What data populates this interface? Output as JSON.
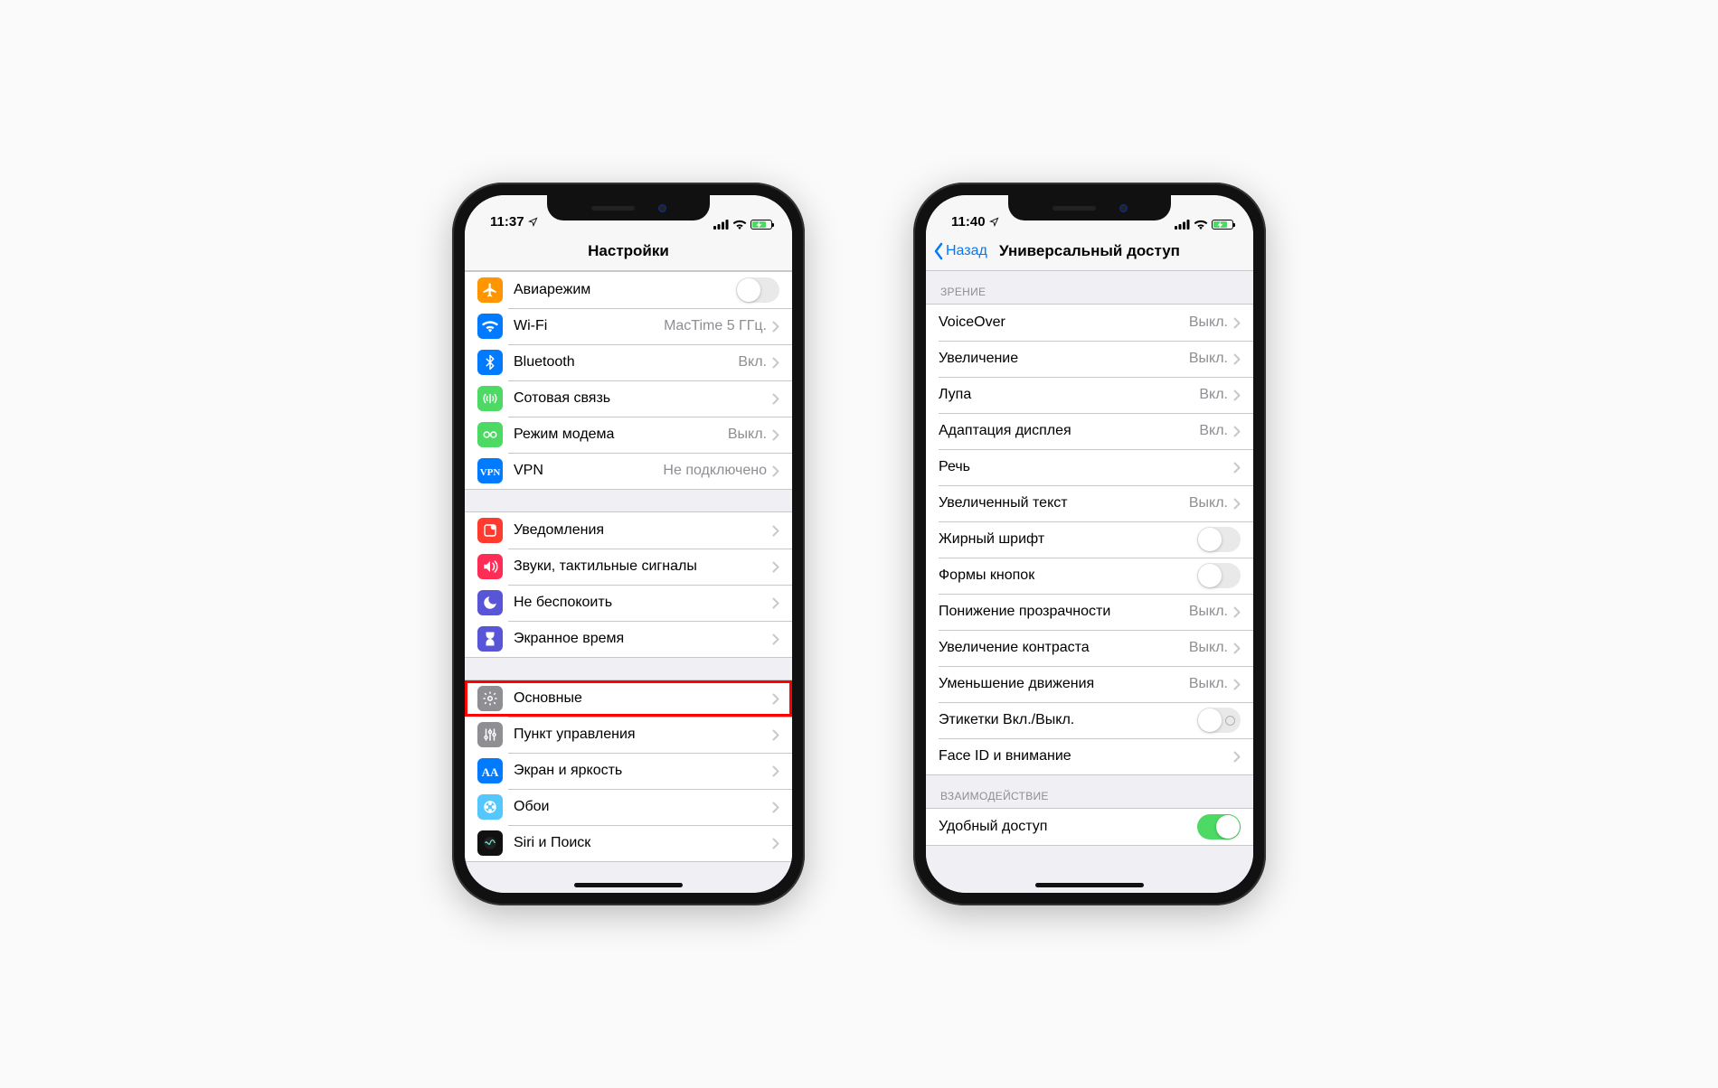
{
  "phone1": {
    "status": {
      "time": "11:37"
    },
    "title": "Настройки",
    "groups": [
      {
        "rows": [
          {
            "key": "airplane",
            "icon": "airplane",
            "iconColor": "#ff9500",
            "label": "Авиарежим",
            "control": "switch",
            "switchOn": false
          },
          {
            "key": "wifi",
            "icon": "wifi",
            "iconColor": "#007aff",
            "label": "Wi-Fi",
            "control": "value",
            "value": "MacTime 5 ГГц."
          },
          {
            "key": "bluetooth",
            "icon": "bluetooth",
            "iconColor": "#007aff",
            "label": "Bluetooth",
            "control": "value",
            "value": "Вкл."
          },
          {
            "key": "cellular",
            "icon": "cellular",
            "iconColor": "#4cd964",
            "label": "Сотовая связь",
            "control": "disclose"
          },
          {
            "key": "hotspot",
            "icon": "hotspot",
            "iconColor": "#4cd964",
            "label": "Режим модема",
            "control": "value",
            "value": "Выкл."
          },
          {
            "key": "vpn",
            "icon": "vpn",
            "iconColor": "#007aff",
            "label": "VPN",
            "control": "value",
            "value": "Не подключено"
          }
        ]
      },
      {
        "rows": [
          {
            "key": "notifications",
            "icon": "notifications",
            "iconColor": "#ff3b30",
            "label": "Уведомления",
            "control": "disclose"
          },
          {
            "key": "sounds",
            "icon": "sounds",
            "iconColor": "#ff2d55",
            "label": "Звуки, тактильные сигналы",
            "control": "disclose"
          },
          {
            "key": "dnd",
            "icon": "dnd",
            "iconColor": "#5856d6",
            "label": "Не беспокоить",
            "control": "disclose"
          },
          {
            "key": "screentime",
            "icon": "screentime",
            "iconColor": "#5856d6",
            "label": "Экранное время",
            "control": "disclose"
          }
        ]
      },
      {
        "rows": [
          {
            "key": "general",
            "icon": "general",
            "iconColor": "#8e8e93",
            "label": "Основные",
            "control": "disclose",
            "highlight": true
          },
          {
            "key": "control",
            "icon": "control",
            "iconColor": "#8e8e93",
            "label": "Пункт управления",
            "control": "disclose"
          },
          {
            "key": "display",
            "icon": "display",
            "iconColor": "#007aff",
            "label": "Экран и яркость",
            "control": "disclose"
          },
          {
            "key": "wallpaper",
            "icon": "wallpaper",
            "iconColor": "#54c7fc",
            "label": "Обои",
            "control": "disclose"
          },
          {
            "key": "siri",
            "icon": "siri",
            "iconColor": "#111111",
            "label": "Siri и Поиск",
            "control": "disclose"
          }
        ]
      }
    ]
  },
  "phone2": {
    "status": {
      "time": "11:40"
    },
    "back": "Назад",
    "title": "Универсальный доступ",
    "sections": [
      {
        "header": "ЗРЕНИЕ",
        "rows": [
          {
            "key": "voiceover",
            "label": "VoiceOver",
            "control": "value",
            "value": "Выкл."
          },
          {
            "key": "zoom",
            "label": "Увеличение",
            "control": "value",
            "value": "Выкл."
          },
          {
            "key": "magnifier",
            "label": "Лупа",
            "control": "value",
            "value": "Вкл."
          },
          {
            "key": "display-accom",
            "label": "Адаптация дисплея",
            "control": "value",
            "value": "Вкл."
          },
          {
            "key": "speech",
            "label": "Речь",
            "control": "disclose"
          },
          {
            "key": "larger-text",
            "label": "Увеличенный текст",
            "control": "value",
            "value": "Выкл."
          },
          {
            "key": "bold-text",
            "label": "Жирный шрифт",
            "control": "switch",
            "switchOn": false
          },
          {
            "key": "button-shapes",
            "label": "Формы кнопок",
            "control": "switch",
            "switchOn": false
          },
          {
            "key": "reduce-trans",
            "label": "Понижение прозрачности",
            "control": "value",
            "value": "Выкл."
          },
          {
            "key": "increase-contrast",
            "label": "Увеличение контраста",
            "control": "value",
            "value": "Выкл."
          },
          {
            "key": "reduce-motion",
            "label": "Уменьшение движения",
            "control": "value",
            "value": "Выкл."
          },
          {
            "key": "onoff-labels",
            "label": "Этикетки Вкл./Выкл.",
            "control": "switch",
            "switchOn": false,
            "switchLabel": true
          },
          {
            "key": "faceid-attention",
            "label": "Face ID и внимание",
            "control": "disclose"
          }
        ]
      },
      {
        "header": "ВЗАИМОДЕЙСТВИЕ",
        "rows": [
          {
            "key": "reachability",
            "label": "Удобный доступ",
            "control": "switch",
            "switchOn": true
          }
        ]
      }
    ]
  }
}
